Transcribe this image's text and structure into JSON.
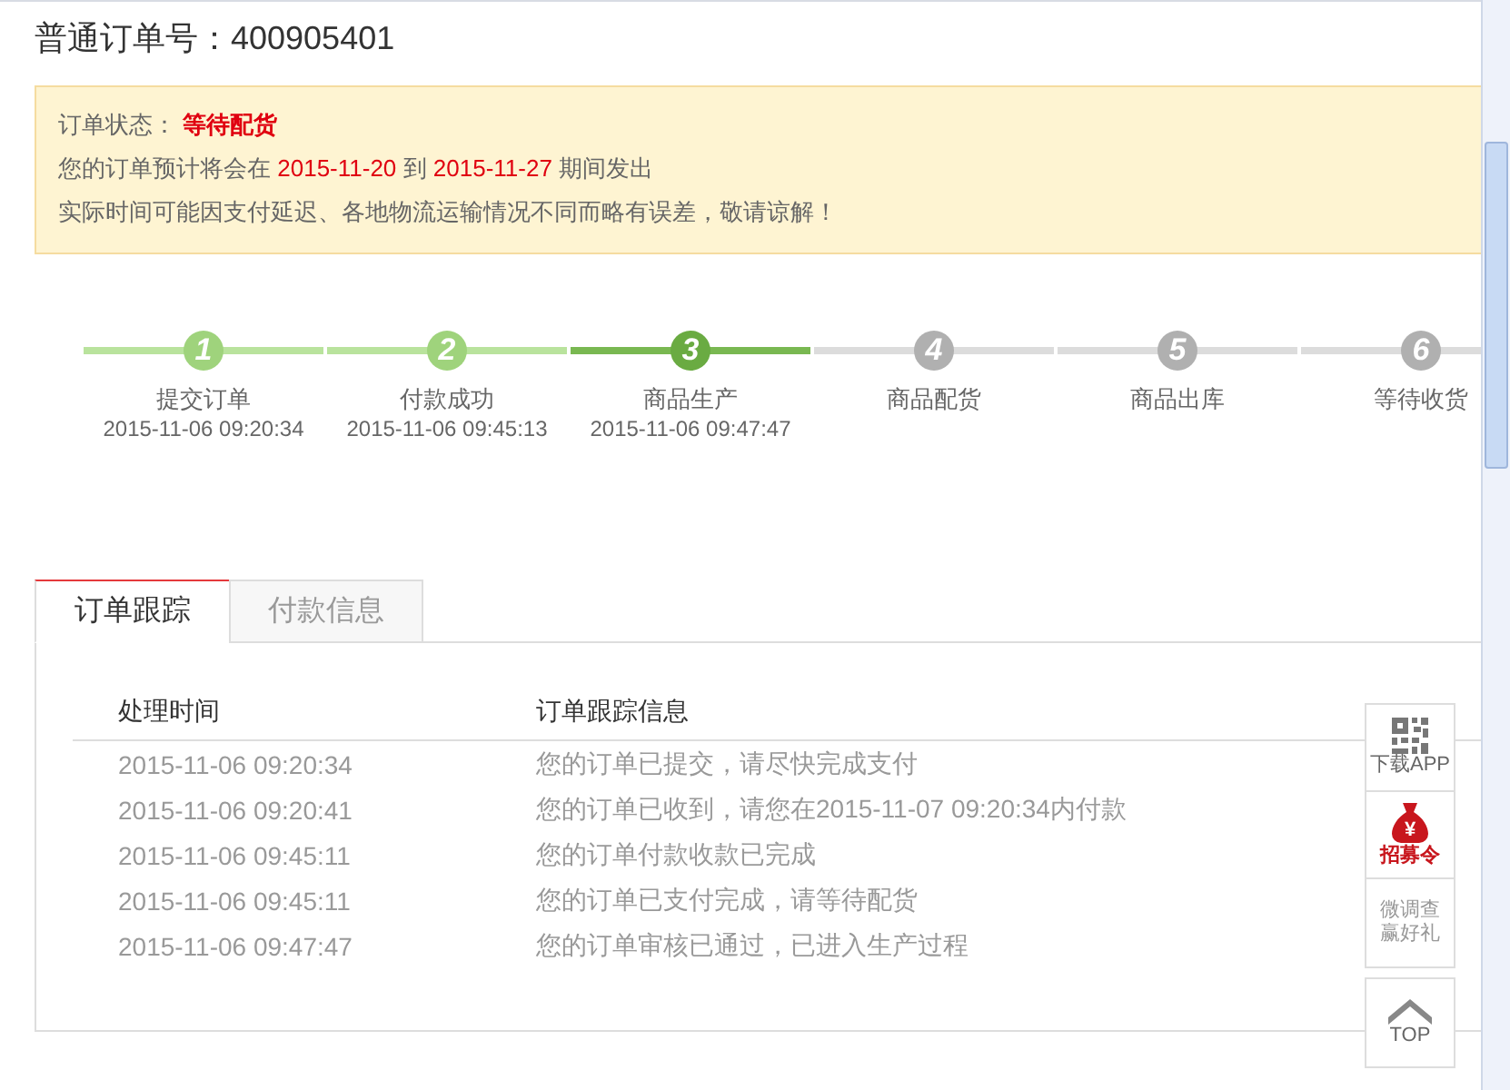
{
  "order_title": {
    "label": "普通订单号：",
    "number": "400905401"
  },
  "notice": {
    "status_label": "订单状态：",
    "status_value": "等待配货",
    "estimate": [
      {
        "text": "您的订单预计将会在 ",
        "highlight": false
      },
      {
        "text": "2015-11-20",
        "highlight": true
      },
      {
        "text": " 到 ",
        "highlight": false
      },
      {
        "text": "2015-11-27",
        "highlight": true
      },
      {
        "text": " 期间发出",
        "highlight": false
      }
    ],
    "disclaimer": "实际时间可能因支付延迟、各地物流运输情况不同而略有误差，敬请谅解！"
  },
  "steps": [
    {
      "number": "1",
      "label": "提交订单",
      "time": "2015-11-06 09:20:34",
      "done": true,
      "current": false
    },
    {
      "number": "2",
      "label": "付款成功",
      "time": "2015-11-06 09:45:13",
      "done": true,
      "current": false
    },
    {
      "number": "3",
      "label": "商品生产",
      "time": "2015-11-06 09:47:47",
      "done": false,
      "current": true
    },
    {
      "number": "4",
      "label": "商品配货",
      "done": false,
      "current": false
    },
    {
      "number": "5",
      "label": "商品出库",
      "done": false,
      "current": false
    },
    {
      "number": "6",
      "label": "等待收货",
      "done": false,
      "current": false
    }
  ],
  "tabs": [
    {
      "label": "订单跟踪",
      "selected": true
    },
    {
      "label": "付款信息",
      "selected": false
    }
  ],
  "table": {
    "columns": [
      "处理时间",
      "订单跟踪信息"
    ],
    "rows": [
      [
        "2015-11-06 09:20:34",
        "您的订单已提交，请尽快完成支付"
      ],
      [
        "2015-11-06 09:20:41",
        "您的订单已收到，请您在2015-11-07 09:20:34内付款"
      ],
      [
        "2015-11-06 09:45:11",
        "您的订单付款收款已完成"
      ],
      [
        "2015-11-06 09:45:11",
        "您的订单已支付完成，请等待配货"
      ],
      [
        "2015-11-06 09:47:47",
        "您的订单审核已通过，已进入生产过程"
      ]
    ]
  },
  "side_tools": [
    {
      "kind": "qr",
      "label": "下载APP"
    },
    {
      "kind": "bag",
      "label": "招募令",
      "icon_text": "¥"
    },
    {
      "kind": "text",
      "label": "微调查赢好礼"
    }
  ],
  "top_button": {
    "label": "TOP"
  }
}
